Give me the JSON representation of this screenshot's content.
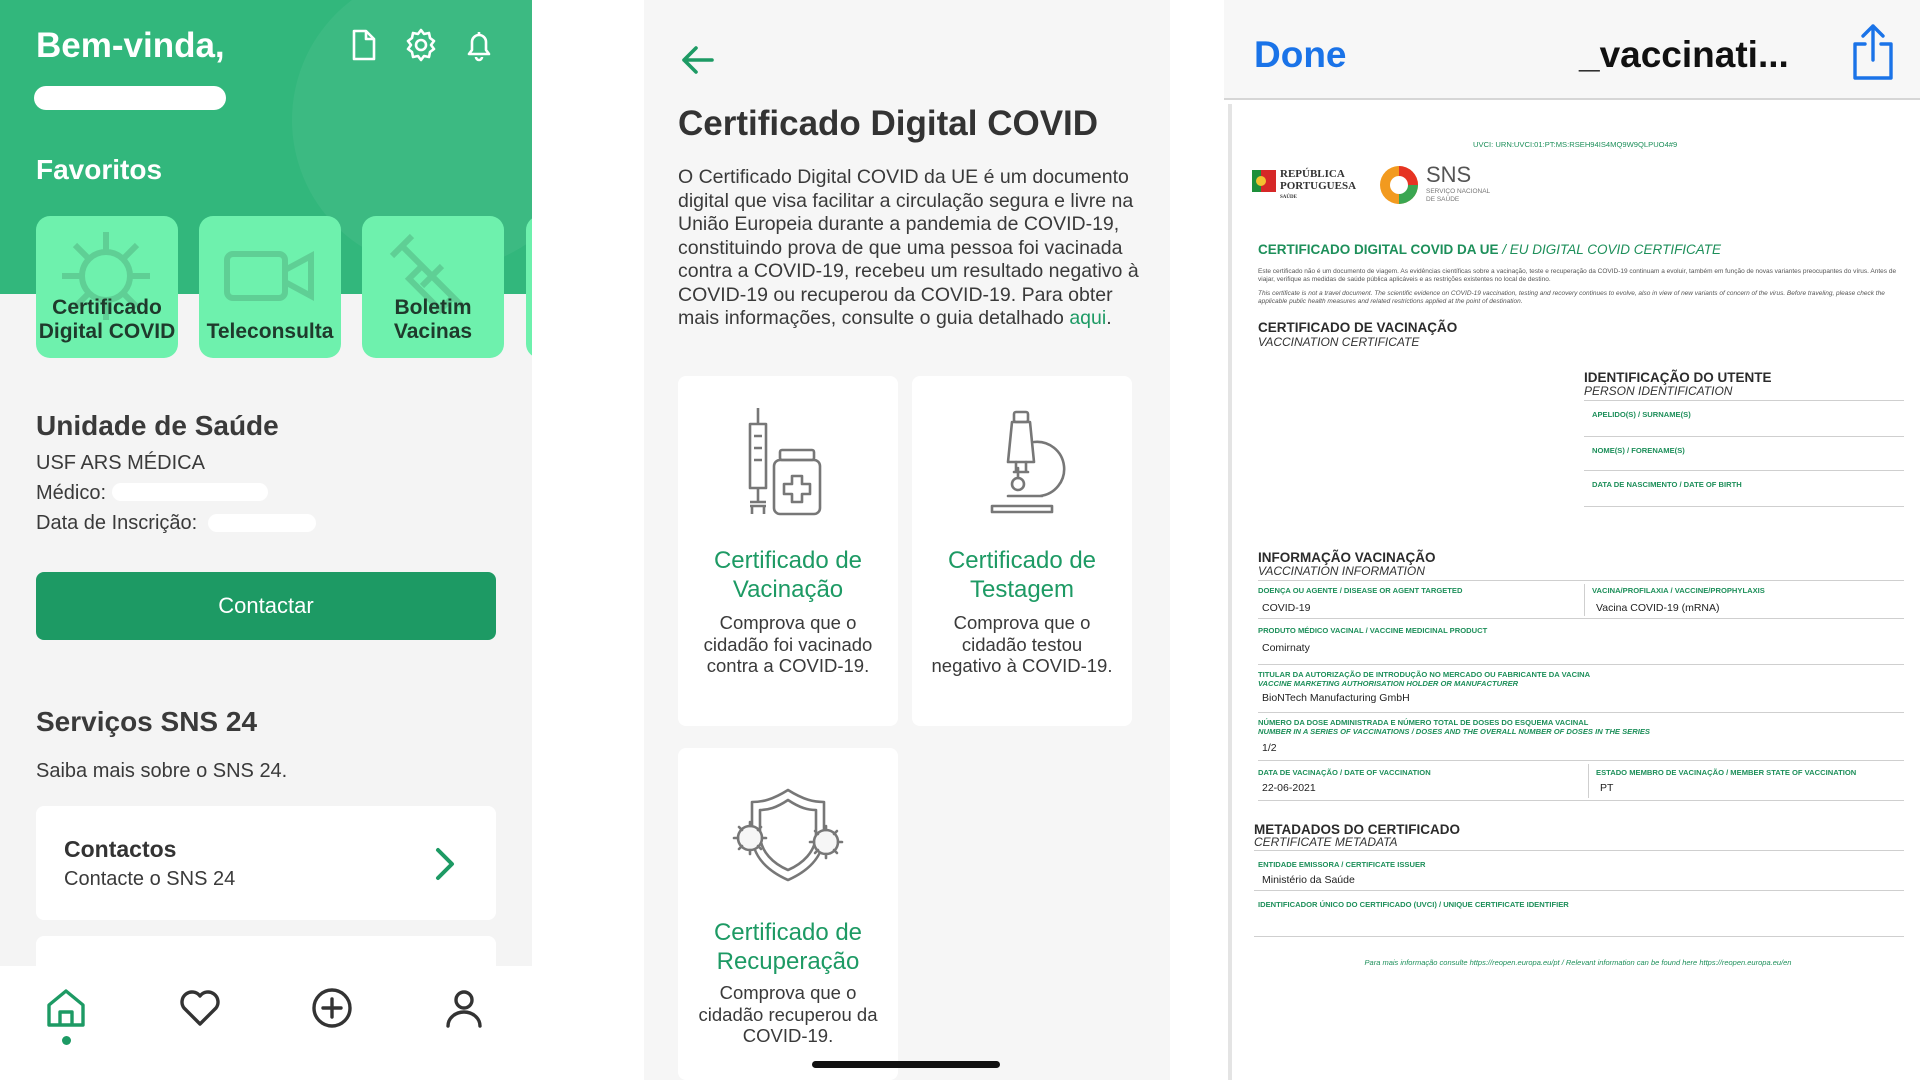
{
  "home": {
    "greeting": "Bem-vinda,",
    "favorites_title": "Favoritos",
    "tiles": [
      {
        "label": "Certificado Digital COVID",
        "icon": "virus-icon"
      },
      {
        "label": "Teleconsulta",
        "icon": "video-camera-icon"
      },
      {
        "label": "Boletim Vacinas",
        "icon": "syringe-icon"
      }
    ],
    "health_unit": {
      "title": "Unidade de Saúde",
      "name": "USF ARS MÉDICA",
      "doctor_label": "Médico:",
      "registration_label": "Data de Inscrição:",
      "contact_button": "Contactar"
    },
    "services": {
      "title": "Serviços SNS 24",
      "subtitle": "Saiba mais sobre o SNS 24.",
      "card_title": "Contactos",
      "card_subtitle": "Contacte o SNS 24"
    },
    "tabbar": [
      "home-icon",
      "heart-icon",
      "plus-circle-icon",
      "user-icon"
    ],
    "accent": "#32b77c",
    "tile_color": "#6ef1ad",
    "button_color": "#1d9a64"
  },
  "certs": {
    "title": "Certificado Digital COVID",
    "body": "O Certificado Digital COVID da UE é um documento digital que  visa facilitar a circulação segura e livre na União Europeia durante a pandemia de COVID-19, constituindo prova de que uma pessoa foi vacinada contra a COVID-19, recebeu um resultado negativo à COVID-19 ou recuperou da COVID-19. Para obter mais informações, consulte o guia detalhado ",
    "link": "aqui",
    "link_suffix": ".",
    "cards": [
      {
        "title": "Certificado de Vacinação",
        "desc": "Comprova que o cidadão foi vacinado contra a COVID-19."
      },
      {
        "title": "Certificado de Testagem",
        "desc": "Comprova que o cidadão testou negativo à COVID-19."
      },
      {
        "title": "Certificado de Recuperação",
        "desc": "Comprova que o cidadão recuperou da COVID-19."
      }
    ]
  },
  "viewer": {
    "done": "Done",
    "filename": "_vaccinati...",
    "pdf": {
      "uvci": "UVCI: URN:UVCI:01:PT:MS:RSEH94IS4MQ9W9QLPUO4#9",
      "republica": "REPÚBLICA",
      "portuguesa": "PORTUGUESA",
      "saude": "SAÚDE",
      "sns": "SNS",
      "sns_sub1": "SERVIÇO NACIONAL",
      "sns_sub2": "DE SAÚDE",
      "cert_title": "CERTIFICADO DIGITAL COVID DA UE",
      "cert_title_en": "/ EU DIGITAL COVID CERTIFICATE",
      "disclaimer_pt": "Este certificado não é um documento de viagem. As evidências científicas sobre a vacinação, teste e recuperação da COVID-19 continuam a evoluir, também em função de novas variantes preocupantes do vírus. Antes de viajar, verifique as medidas de saúde pública aplicáveis e as restrições existentes no local de destino.",
      "disclaimer_en": "This certificate is not a travel document. The scientific evidence on COVID-19 vaccination, testing and recovery continues to evolve, also in view of new variants of concern of the virus. Before traveling, please check the applicable public health measures and related restrictions applied at the point of destination.",
      "vac_cert": "CERTIFICADO DE VACINAÇÃO",
      "vac_cert_en": "VACCINATION CERTIFICATE",
      "person_id": "IDENTIFICAÇÃO DO UTENTE",
      "person_id_en": "PERSON IDENTIFICATION",
      "surname": "APELIDO(S) / SURNAME(S)",
      "forename": "NOME(S) / FORENAME(S)",
      "dob": "DATA DE NASCIMENTO / DATE OF BIRTH",
      "vac_info": "INFORMAÇÃO VACINAÇÃO",
      "vac_info_en": "VACCINATION INFORMATION",
      "disease_lbl": "DOENÇA OU AGENTE / DISEASE OR AGENT TARGETED",
      "disease_val": "COVID-19",
      "prophylaxis_lbl": "VACINA/PROFILAXIA / VACCINE/PROPHYLAXIS",
      "prophylaxis_val": "Vacina COVID-19 (mRNA)",
      "product_lbl": "PRODUTO MÉDICO VACINAL / VACCINE MEDICINAL PRODUCT",
      "product_val": "Comirnaty",
      "holder_lbl1": "TITULAR DA AUTORIZAÇÃO DE INTRODUÇÃO NO MERCADO OU FABRICANTE DA VACINA",
      "holder_lbl2": "VACCINE MARKETING AUTHORISATION HOLDER OR MANUFACTURER",
      "holder_val": "BioNTech Manufacturing GmbH",
      "dose_lbl1": "NÚMERO DA DOSE ADMINISTRADA E NÚMERO TOTAL DE DOSES DO ESQUEMA VACINAL",
      "dose_lbl2": "NUMBER IN A SERIES OF VACCINATIONS / DOSES AND THE OVERALL NUMBER OF DOSES IN THE SERIES",
      "dose_val": "1/2",
      "date_lbl": "DATA DE VACINAÇÃO / DATE OF VACCINATION",
      "date_val": "22-06-2021",
      "state_lbl": "ESTADO MEMBRO DE VACINAÇÃO / MEMBER STATE OF VACCINATION",
      "state_val": "PT",
      "meta": "METADADOS DO CERTIFICADO",
      "meta_en": "CERTIFICATE METADATA",
      "issuer_lbl": "ENTIDADE EMISSORA / CERTIFICATE ISSUER",
      "issuer_val": "Ministério da Saúde",
      "uvci_lbl": "IDENTIFICADOR ÚNICO DO CERTIFICADO (UVCI) / UNIQUE CERTIFICATE IDENTIFIER",
      "footer": "Para mais informação consulte https://reopen.europa.eu/pt / Relevant information can be found here https://reopen.europa.eu/en"
    }
  }
}
